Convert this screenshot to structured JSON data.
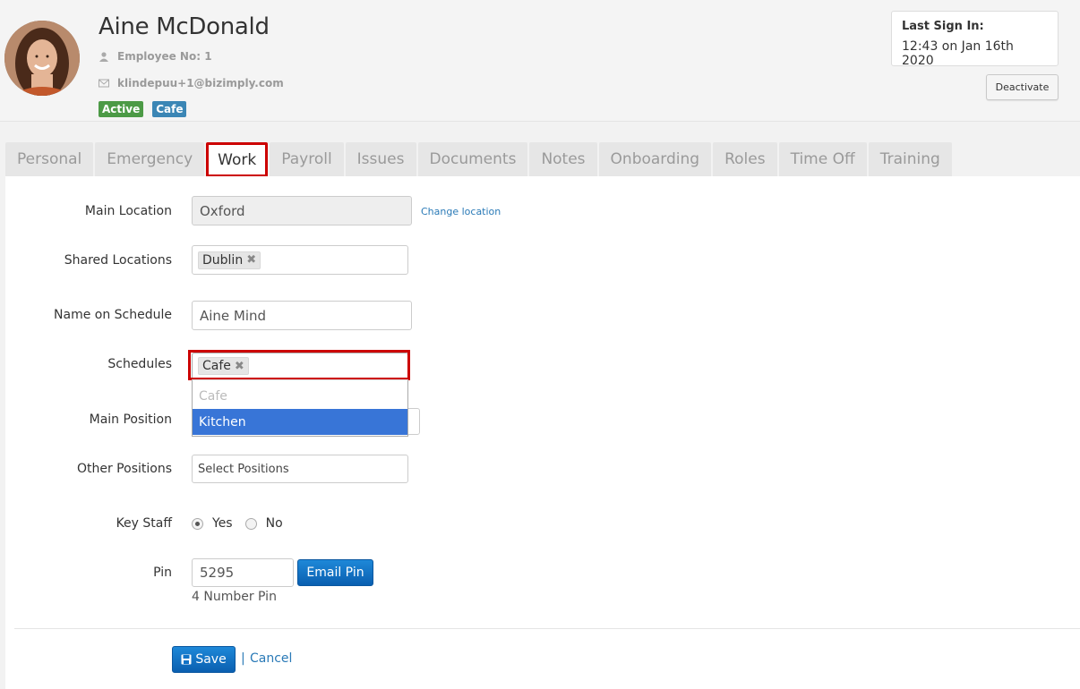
{
  "profile": {
    "name": "Aine McDonald",
    "employee_no": "Employee No: 1",
    "email": "klindepuu+1@bizimply.com",
    "badges": [
      "Active",
      "Cafe"
    ],
    "last_sign_in_title": "Last Sign In:",
    "last_sign_in_value": "12:43 on Jan 16th 2020",
    "deactivate_label": "Deactivate"
  },
  "tabs": [
    "Personal",
    "Emergency",
    "Work",
    "Payroll",
    "Issues",
    "Documents",
    "Notes",
    "Onboarding",
    "Roles",
    "Time Off",
    "Training"
  ],
  "active_tab": "Work",
  "form": {
    "main_location_label": "Main Location",
    "main_location_value": "Oxford",
    "change_location": "Change location",
    "shared_locations_label": "Shared Locations",
    "shared_location_tag": "Dublin",
    "name_on_schedule_label": "Name on Schedule",
    "name_on_schedule_value": "Aine Mind",
    "schedules_label": "Schedules",
    "schedules_tag": "Cafe",
    "schedule_options": [
      "Cafe",
      "Kitchen"
    ],
    "main_position_label": "Main Position",
    "other_positions_label": "Other Positions",
    "other_positions_placeholder": "Select Positions",
    "key_staff_label": "Key Staff",
    "key_staff_yes": "Yes",
    "key_staff_no": "No",
    "pin_label": "Pin",
    "pin_value": "5295",
    "email_pin": "Email Pin",
    "pin_hint": "4 Number Pin",
    "save": "Save",
    "separator": "|",
    "cancel": "Cancel"
  },
  "colors": {
    "active_badge": "#4c9a46",
    "cafe_badge": "#3b86b5",
    "highlight": "#cc0000",
    "primary_button": "#1173c7",
    "link": "#2a7ab7"
  }
}
